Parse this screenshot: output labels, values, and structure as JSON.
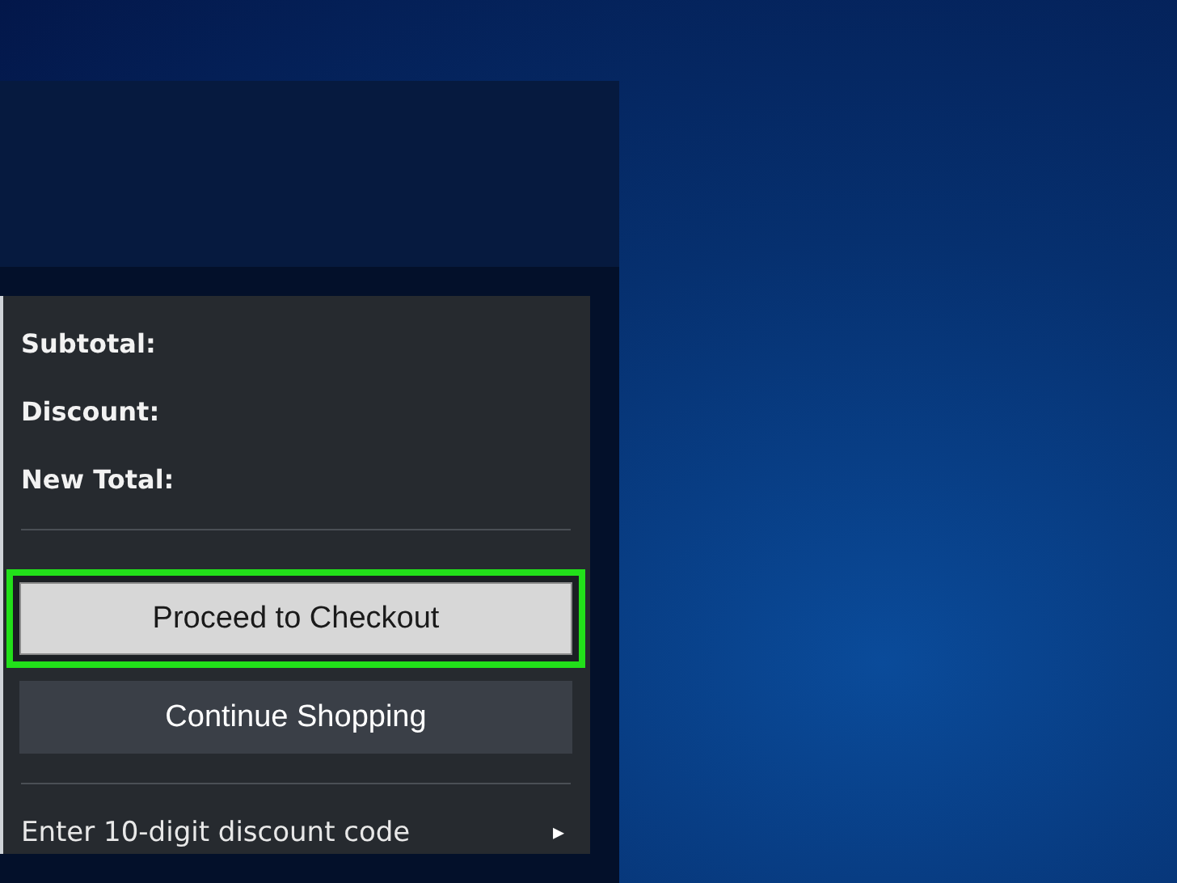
{
  "summary": {
    "lines": [
      {
        "label": "Subtotal:"
      },
      {
        "label": "Discount:"
      },
      {
        "label": "New Total:"
      }
    ]
  },
  "buttons": [
    {
      "label": "Proceed to Checkout",
      "kind": "primary",
      "highlighted": true
    },
    {
      "label": "Continue Shopping",
      "kind": "secondary",
      "highlighted": false
    }
  ],
  "discount_code": {
    "label": "Enter 10-digit discount code",
    "arrow": "▸"
  }
}
